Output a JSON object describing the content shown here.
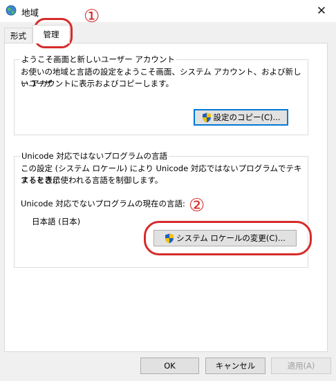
{
  "window": {
    "title": "地域",
    "close_glyph": "✕"
  },
  "tabs": [
    {
      "label": "形式"
    },
    {
      "label": "管理"
    }
  ],
  "welcome_group": {
    "legend": "ようこそ画面と新しいユーザー アカウント",
    "description_line1": "お使いの地域と言語の設定をようこそ画面、システム アカウント、および新しいユーザ",
    "description_line2": "ー アカウントに表示およびコピーします。",
    "copy_button": "設定のコピー(C)..."
  },
  "unicode_group": {
    "legend": "Unicode 対応ではないプログラムの言語",
    "description_line1": "この設定 (システム ロケール) により Unicode 対応ではないプログラムでテキストを表示",
    "description_line2": "するときに使われる言語を制御します。",
    "current_label": "Unicode 対応でないプログラムの現在の言語:",
    "current_value": "日本語 (日本)",
    "change_button": "システム ロケールの変更(C)..."
  },
  "annotations": {
    "marker1": "①",
    "marker2": "②",
    "color": "#d62a2a"
  },
  "footer": {
    "ok": "OK",
    "cancel": "キャンセル",
    "apply": "適用(A)"
  },
  "colors": {
    "focus_border": "#0078d7",
    "shield_blue": "#1f5fbf",
    "shield_yellow": "#f2c200"
  }
}
